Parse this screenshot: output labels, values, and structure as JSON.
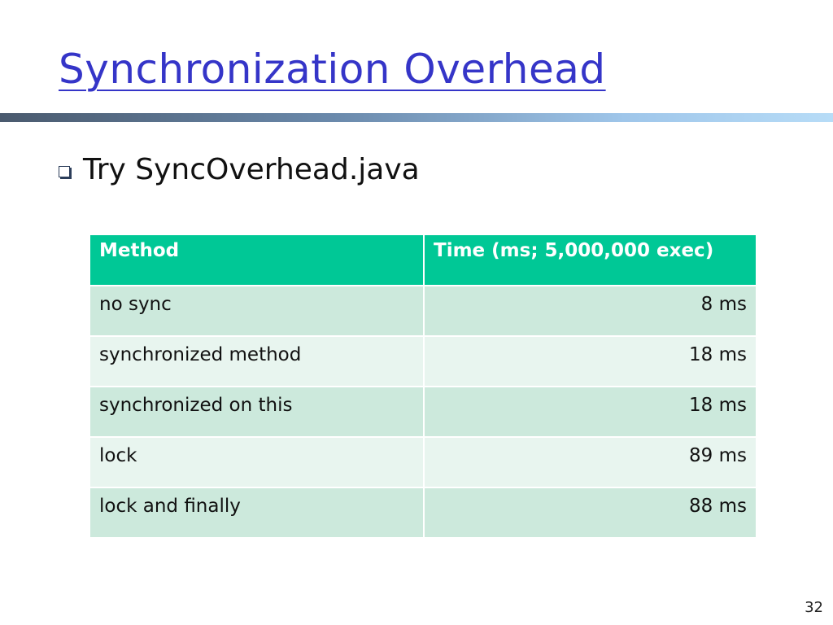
{
  "slide": {
    "title": "Synchronization Overhead",
    "bullet": "Try SyncOverhead.java",
    "page_number": "32"
  },
  "table": {
    "headers": [
      "Method",
      "Time (ms; 5,000,000 exec)"
    ],
    "rows": [
      {
        "method": "no sync",
        "time": "8 ms"
      },
      {
        "method": "synchronized method",
        "time": "18 ms"
      },
      {
        "method": "synchronized on this",
        "time": "18 ms"
      },
      {
        "method": "lock",
        "time": "89 ms"
      },
      {
        "method": "lock and finally",
        "time": "88 ms"
      }
    ]
  },
  "colors": {
    "title": "#3535c8",
    "header_bg": "#00c896",
    "row_dark": "#cce9dc",
    "row_light": "#e8f5ef"
  },
  "icons": {
    "bullet": "hollow-square-bullet-icon"
  }
}
